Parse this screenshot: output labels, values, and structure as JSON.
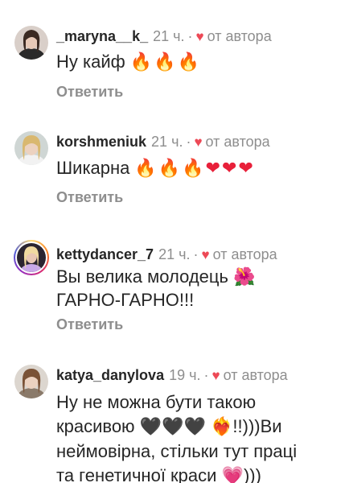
{
  "comments": [
    {
      "username": "_maryna__k_",
      "time": "21 ч.",
      "separator": "·",
      "by_author": "от автора",
      "text": "Ну кайф",
      "emojis": "🔥🔥🔥",
      "reply": "Ответить",
      "avatar_icon": "avatar-photo"
    },
    {
      "username": "korshmeniuk",
      "time": "21 ч.",
      "separator": "·",
      "by_author": "от автора",
      "text": "Шикарна",
      "emojis": "🔥🔥🔥❤❤❤",
      "reply": "Ответить",
      "avatar_icon": "avatar-photo"
    },
    {
      "username": "kettydancer_7",
      "time": "21 ч.",
      "separator": "·",
      "by_author": "от автора",
      "text_line1": "Вы велика молодець",
      "flower": "🌺",
      "text_line2": "ГАРНО-ГАРНО!!!",
      "reply": "Ответить",
      "avatar_icon": "avatar-photo-story-ring"
    },
    {
      "username": "katya_danylova",
      "time": "19 ч.",
      "separator": "·",
      "by_author": "от автора",
      "line1": "Ну не можна бути такою",
      "line2_start": "красивою",
      "black_hearts": "🖤🖤🖤",
      "burning_heart": "❤️‍🔥",
      "line2_end": "!!)))Ви",
      "line3": "неймовірна, стільки тут праці",
      "line4_start": "та генетичної краси",
      "pink_heart": "💗",
      "line4_end": ")))",
      "avatar_icon": "avatar-photo"
    }
  ],
  "colors": {
    "text": "#262626",
    "muted": "#8e8e8e",
    "heart": "#ed4956"
  }
}
